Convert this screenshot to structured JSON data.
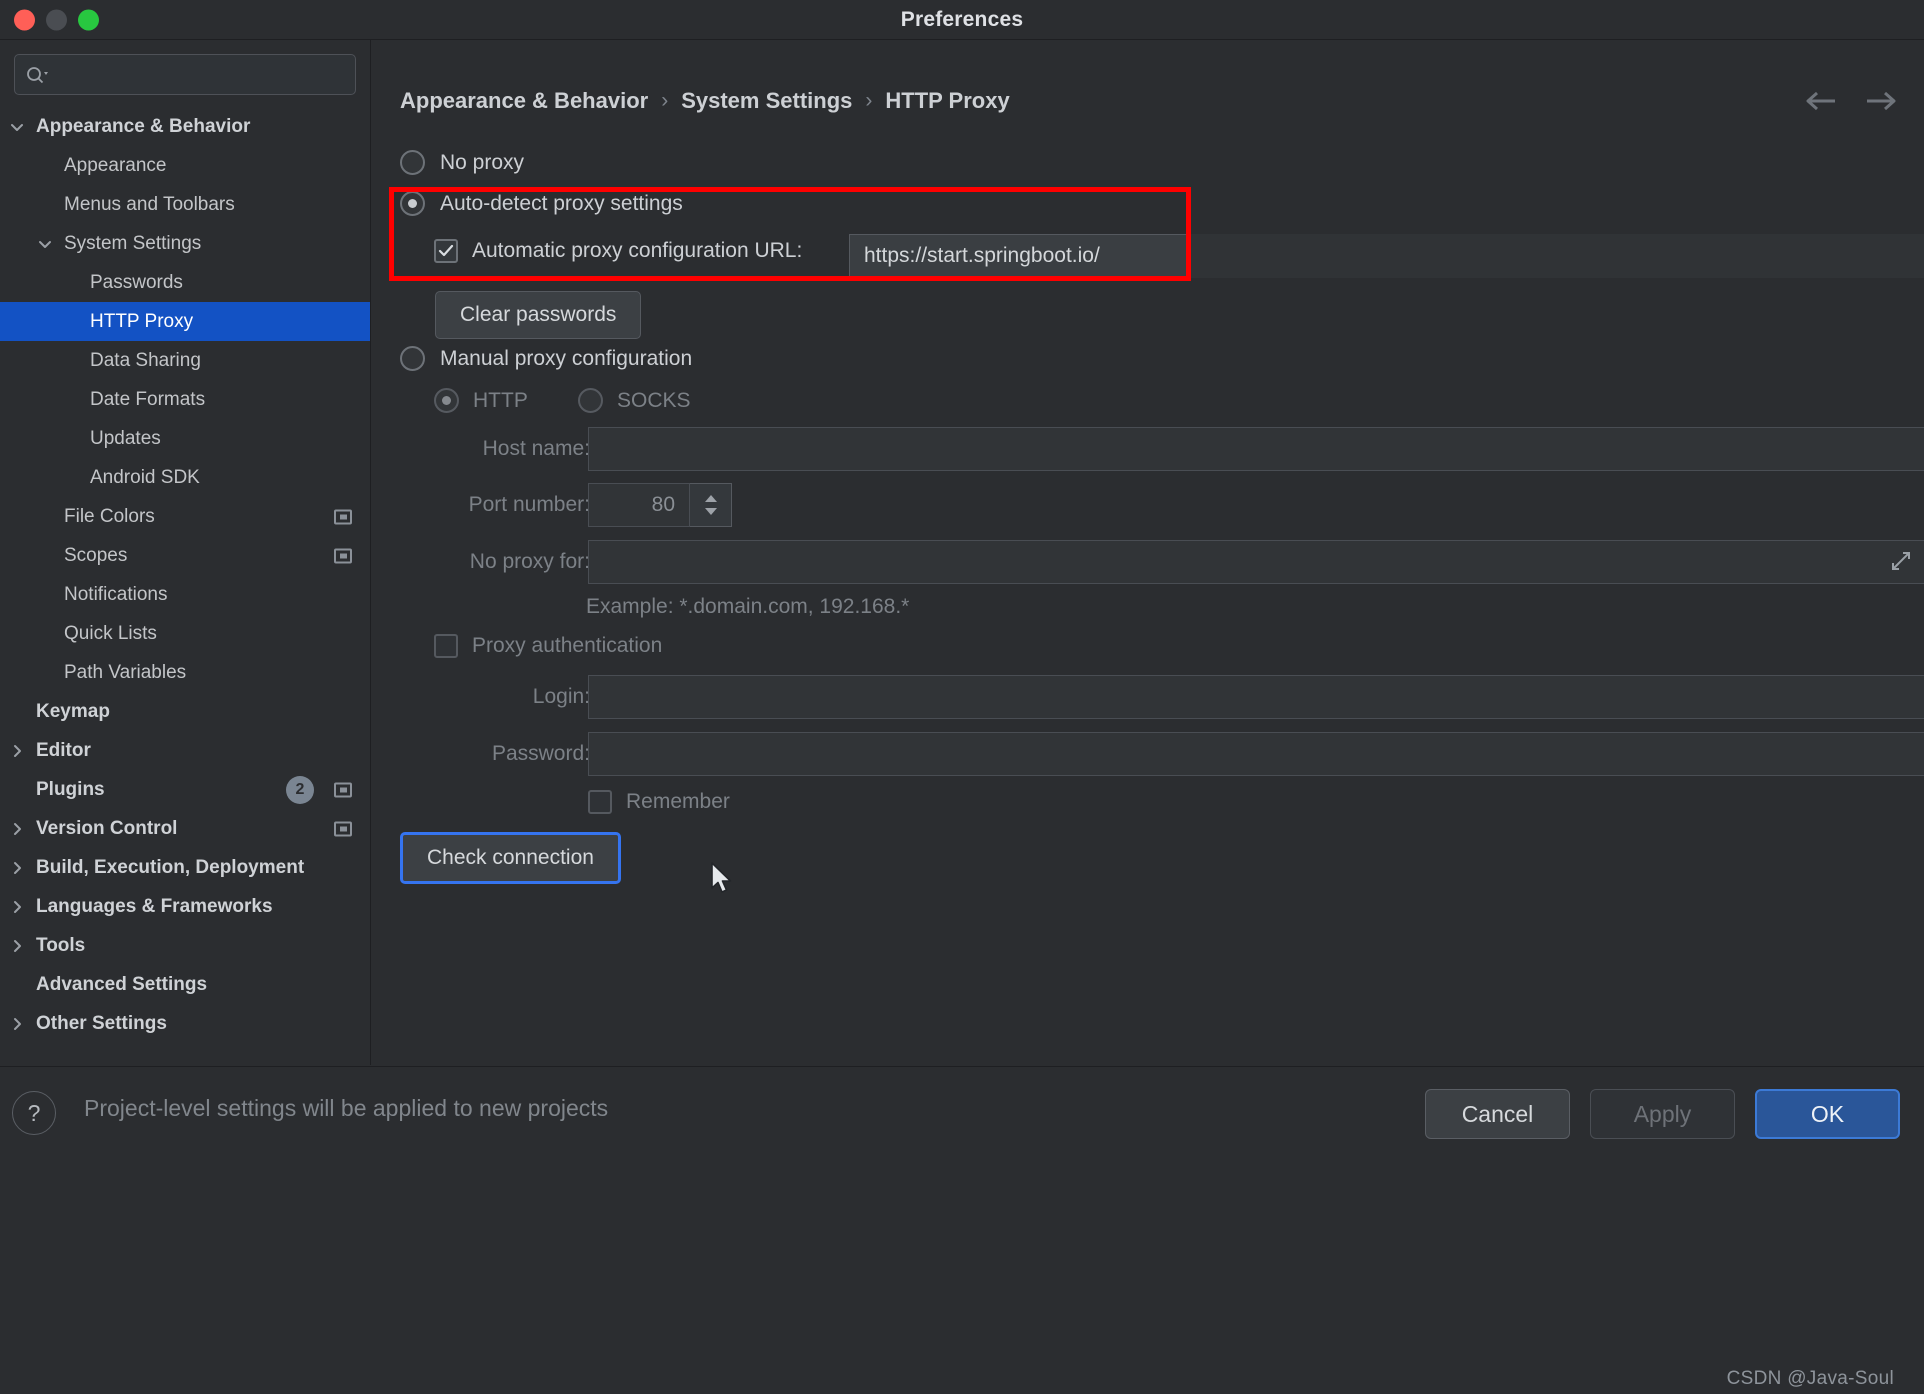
{
  "window": {
    "title": "Preferences",
    "controls": [
      "close",
      "minimize",
      "zoom"
    ]
  },
  "sidebar": {
    "search": {
      "placeholder": "",
      "value": ""
    },
    "items": [
      {
        "label": "Appearance & Behavior",
        "indent": 36,
        "chev": "down",
        "bold": true,
        "selected": false
      },
      {
        "label": "Appearance",
        "indent": 64,
        "chev": "none",
        "bold": false,
        "selected": false
      },
      {
        "label": "Menus and Toolbars",
        "indent": 64,
        "chev": "none",
        "bold": false,
        "selected": false
      },
      {
        "label": "System Settings",
        "indent": 64,
        "chev": "down",
        "bold": false,
        "selected": false
      },
      {
        "label": "Passwords",
        "indent": 90,
        "chev": "none",
        "bold": false,
        "selected": false
      },
      {
        "label": "HTTP Proxy",
        "indent": 90,
        "chev": "none",
        "bold": false,
        "selected": true
      },
      {
        "label": "Data Sharing",
        "indent": 90,
        "chev": "none",
        "bold": false,
        "selected": false
      },
      {
        "label": "Date Formats",
        "indent": 90,
        "chev": "none",
        "bold": false,
        "selected": false
      },
      {
        "label": "Updates",
        "indent": 90,
        "chev": "none",
        "bold": false,
        "selected": false
      },
      {
        "label": "Android SDK",
        "indent": 90,
        "chev": "none",
        "bold": false,
        "selected": false
      },
      {
        "label": "File Colors",
        "indent": 64,
        "chev": "none",
        "bold": false,
        "selected": false,
        "scope_icon": true
      },
      {
        "label": "Scopes",
        "indent": 64,
        "chev": "none",
        "bold": false,
        "selected": false,
        "scope_icon": true
      },
      {
        "label": "Notifications",
        "indent": 64,
        "chev": "none",
        "bold": false,
        "selected": false
      },
      {
        "label": "Quick Lists",
        "indent": 64,
        "chev": "none",
        "bold": false,
        "selected": false
      },
      {
        "label": "Path Variables",
        "indent": 64,
        "chev": "none",
        "bold": false,
        "selected": false
      },
      {
        "label": "Keymap",
        "indent": 36,
        "chev": "none",
        "bold": true,
        "selected": false
      },
      {
        "label": "Editor",
        "indent": 36,
        "chev": "right",
        "bold": true,
        "selected": false
      },
      {
        "label": "Plugins",
        "indent": 36,
        "chev": "none",
        "bold": true,
        "selected": false,
        "badge": "2",
        "scope_icon": true
      },
      {
        "label": "Version Control",
        "indent": 36,
        "chev": "right",
        "bold": true,
        "selected": false,
        "scope_icon": true
      },
      {
        "label": "Build, Execution, Deployment",
        "indent": 36,
        "chev": "right",
        "bold": true,
        "selected": false
      },
      {
        "label": "Languages & Frameworks",
        "indent": 36,
        "chev": "right",
        "bold": true,
        "selected": false
      },
      {
        "label": "Tools",
        "indent": 36,
        "chev": "right",
        "bold": true,
        "selected": false
      },
      {
        "label": "Advanced Settings",
        "indent": 36,
        "chev": "none",
        "bold": true,
        "selected": false
      },
      {
        "label": "Other Settings",
        "indent": 36,
        "chev": "right",
        "bold": true,
        "selected": false
      }
    ]
  },
  "breadcrumb": {
    "crumb1": "Appearance & Behavior",
    "crumb2": "System Settings",
    "crumb3": "HTTP Proxy",
    "separator": "›",
    "back_icon": "arrow-left-icon",
    "forward_icon": "arrow-right-icon"
  },
  "proxy": {
    "no_proxy_label": "No proxy",
    "no_proxy_selected": false,
    "auto_detect_label": "Auto-detect proxy settings",
    "auto_detect_selected": true,
    "auto_config_url_label": "Automatic proxy configuration URL:",
    "auto_config_url_checked": true,
    "auto_config_url_value": "https://start.springboot.io/",
    "clear_passwords_label": "Clear passwords",
    "manual_label": "Manual proxy configuration",
    "manual_selected": false,
    "http_label": "HTTP",
    "http_selected": true,
    "socks_label": "SOCKS",
    "socks_selected": false,
    "host_name_label": "Host name:",
    "host_name_value": "",
    "port_number_label": "Port number:",
    "port_number_value": "80",
    "no_proxy_for_label": "No proxy for:",
    "no_proxy_for_value": "",
    "example_text": "Example: *.domain.com, 192.168.*",
    "proxy_auth_label": "Proxy authentication",
    "proxy_auth_checked": false,
    "login_label": "Login:",
    "login_value": "",
    "password_label": "Password:",
    "password_value": "",
    "remember_label": "Remember",
    "remember_checked": false,
    "check_connection_label": "Check connection",
    "expand_icon": "expand-icon",
    "highlight_color": "#ff0000"
  },
  "footer": {
    "help_icon": "?",
    "hint": "Project-level settings will be applied to new projects",
    "cancel_label": "Cancel",
    "apply_label": "Apply",
    "ok_label": "OK",
    "watermark": "CSDN @Java-Soul"
  }
}
